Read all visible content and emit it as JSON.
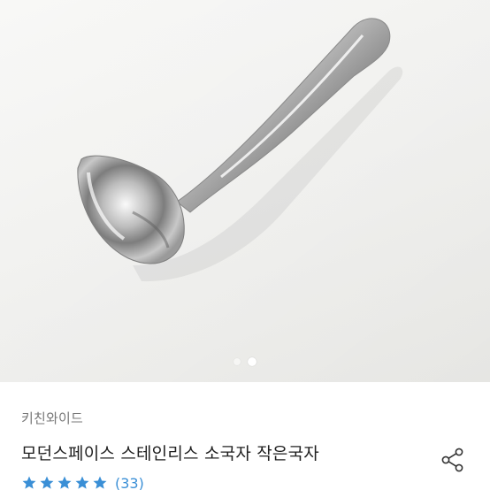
{
  "product": {
    "seller": "키친와이드",
    "title": "모던스페이스 스테인리스 소국자 작은국자",
    "review_count": "(33)",
    "rating": 5,
    "rating_max": 5
  },
  "gallery": {
    "image_count": 2,
    "active_index": 1
  },
  "icons": {
    "share": "share-icon",
    "star": "star-icon"
  },
  "colors": {
    "star": "#3a8fd6",
    "review_count": "#3a8fd6",
    "seller": "#777777",
    "title": "#1f1f1f"
  }
}
